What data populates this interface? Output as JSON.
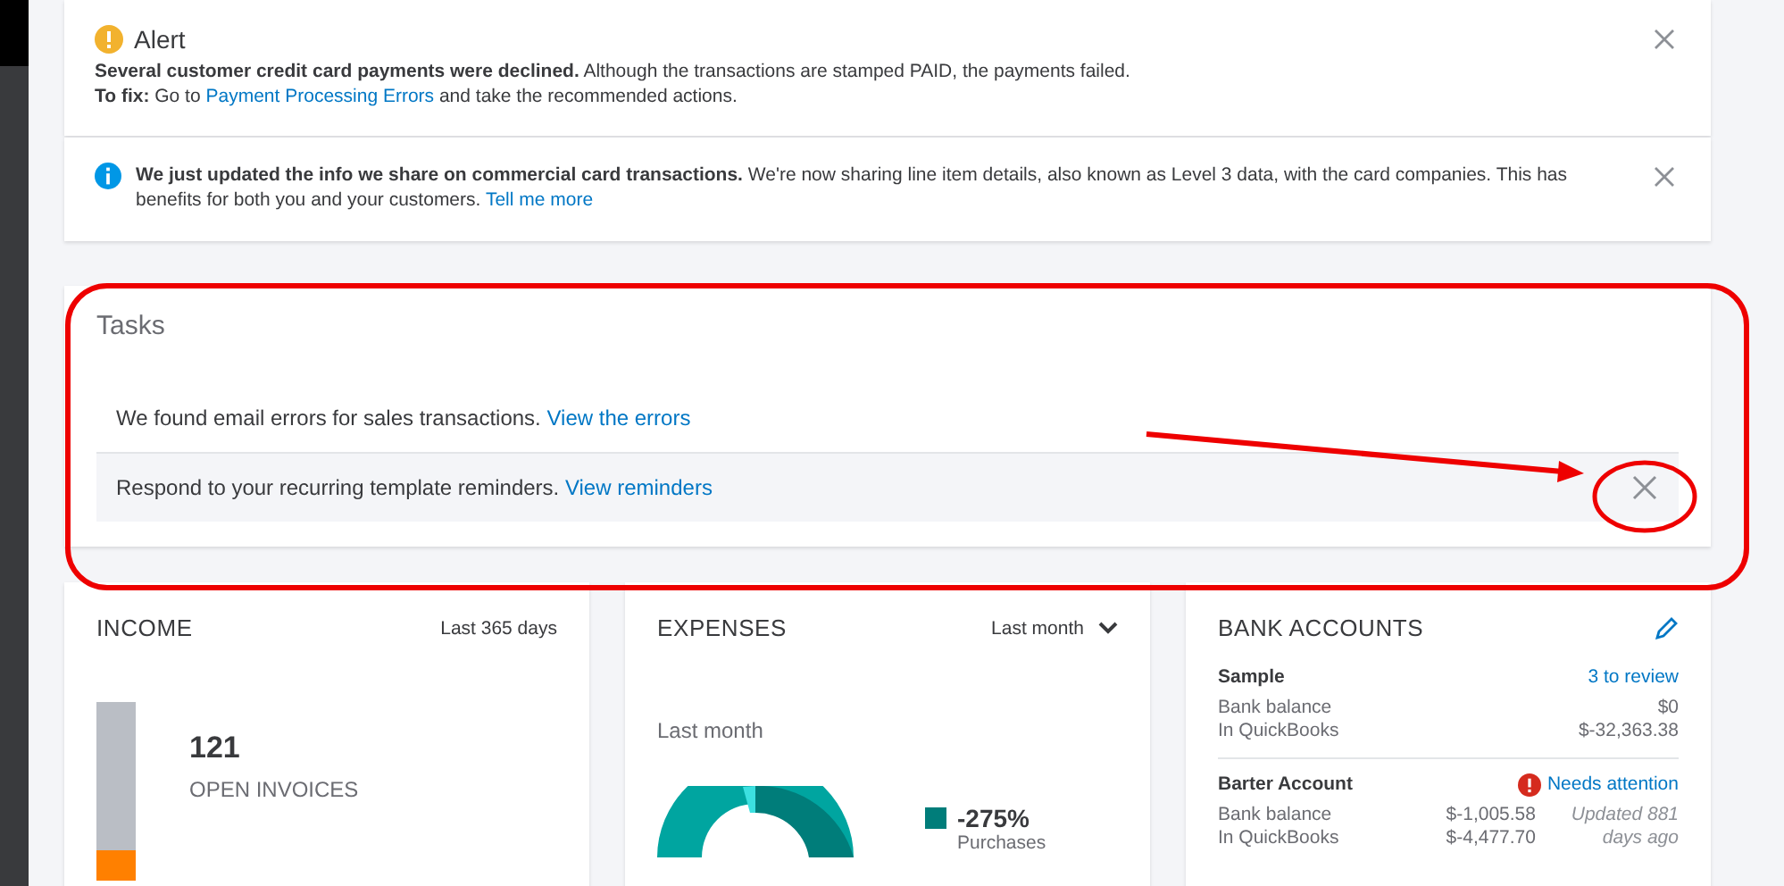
{
  "alerts": [
    {
      "kind": "warning",
      "title": "Alert",
      "lines": [
        {
          "text": "**Several customer credit card payments were declined.** Although the transactions are stamped PAID, the payments failed."
        },
        {
          "text": "**To fix:** Go to",
          "link": "Payment Processing Errors",
          "after": "and take the recommended actions."
        }
      ]
    },
    {
      "kind": "info",
      "lines": [
        {
          "text": "**We just updated the info we share on commercial card transactions.** We're now sharing line item details, also known as Level 3 data, with the card companies. This has benefits for both you and your customers.",
          "link": "Tell me more"
        }
      ]
    }
  ],
  "tasks": {
    "title": "Tasks",
    "items": [
      {
        "text": "We found email errors for sales transactions.",
        "link": "View the errors",
        "highlighted": false
      },
      {
        "text": "Respond to your recurring template reminders.",
        "link": "View reminders",
        "highlighted": true
      }
    ]
  },
  "income": {
    "title": "INCOME",
    "period": "Last 365 days",
    "count": "121",
    "label": "OPEN INVOICES"
  },
  "expenses": {
    "title": "EXPENSES",
    "period": "Last month",
    "subtitle": "Last month",
    "legend": [
      {
        "value": "-275%",
        "label": "Purchases",
        "color": "#007d7a"
      }
    ]
  },
  "bank_accounts": {
    "title": "BANK ACCOUNTS",
    "accounts": [
      {
        "name": "Sample",
        "status": "3 to review",
        "warning": false,
        "rows": [
          {
            "label": "Bank balance",
            "amount": "$0"
          },
          {
            "label": "In QuickBooks",
            "amount": "$-32,363.38"
          }
        ]
      },
      {
        "name": "Barter Account",
        "status": "Needs attention",
        "warning": true,
        "note": "Updated 881 days ago",
        "rows": [
          {
            "label": "Bank balance",
            "amount": "$-1,005.58"
          },
          {
            "label": "In QuickBooks",
            "amount": "$-4,477.70"
          }
        ]
      }
    ]
  }
}
